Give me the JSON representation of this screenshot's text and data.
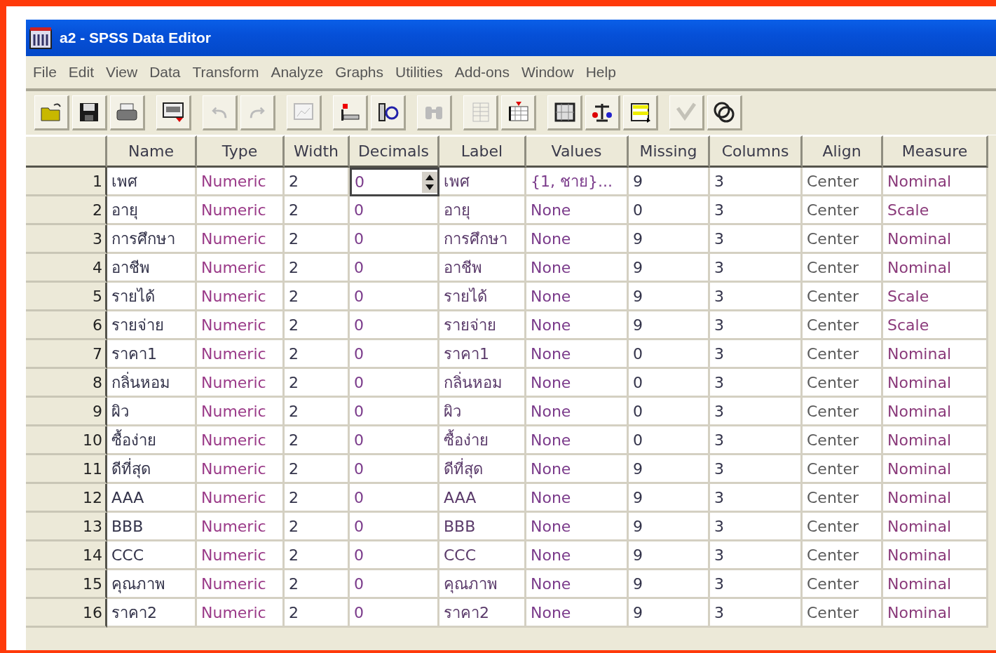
{
  "window": {
    "title": "a2 - SPSS Data Editor"
  },
  "menu": [
    "File",
    "Edit",
    "View",
    "Data",
    "Transform",
    "Analyze",
    "Graphs",
    "Utilities",
    "Add-ons",
    "Window",
    "Help"
  ],
  "toolbar": [
    {
      "disabled": false
    },
    {
      "disabled": false
    },
    {
      "disabled": false
    },
    {
      "disabled": false
    },
    {
      "disabled": true
    },
    {
      "disabled": true
    },
    {
      "disabled": true
    },
    {
      "disabled": false
    },
    {
      "disabled": false
    },
    {
      "disabled": true
    },
    {
      "disabled": true
    },
    {
      "disabled": false
    },
    {
      "disabled": false
    },
    {
      "disabled": false
    },
    {
      "disabled": false
    },
    {
      "disabled": true
    },
    {
      "disabled": false
    }
  ],
  "table": {
    "columns": [
      "Name",
      "Type",
      "Width",
      "Decimals",
      "Label",
      "Values",
      "Missing",
      "Columns",
      "Align",
      "Measure"
    ],
    "rows": [
      {
        "number": "1",
        "cells": [
          "เพศ",
          "Numeric",
          "2",
          "0",
          "เพศ",
          "{1, ชาย}...",
          "9",
          "3",
          "Center",
          "Nominal"
        ],
        "editing_decimals": true
      },
      {
        "number": "2",
        "cells": [
          "อายุ",
          "Numeric",
          "2",
          "0",
          "อายุ",
          "None",
          "0",
          "3",
          "Center",
          "Scale"
        ],
        "editing_decimals": false
      },
      {
        "number": "3",
        "cells": [
          "การศึกษา",
          "Numeric",
          "2",
          "0",
          "การศึกษา",
          "None",
          "9",
          "3",
          "Center",
          "Nominal"
        ],
        "editing_decimals": false
      },
      {
        "number": "4",
        "cells": [
          "อาชีพ",
          "Numeric",
          "2",
          "0",
          "อาชีพ",
          "None",
          "9",
          "3",
          "Center",
          "Nominal"
        ],
        "editing_decimals": false
      },
      {
        "number": "5",
        "cells": [
          "รายได้",
          "Numeric",
          "2",
          "0",
          "รายได้",
          "None",
          "9",
          "3",
          "Center",
          "Scale"
        ],
        "editing_decimals": false
      },
      {
        "number": "6",
        "cells": [
          "รายจ่าย",
          "Numeric",
          "2",
          "0",
          "รายจ่าย",
          "None",
          "9",
          "3",
          "Center",
          "Scale"
        ],
        "editing_decimals": false
      },
      {
        "number": "7",
        "cells": [
          "ราคา1",
          "Numeric",
          "2",
          "0",
          "ราคา1",
          "None",
          "0",
          "3",
          "Center",
          "Nominal"
        ],
        "editing_decimals": false
      },
      {
        "number": "8",
        "cells": [
          "กลิ่นหอม",
          "Numeric",
          "2",
          "0",
          "กลิ่นหอม",
          "None",
          "0",
          "3",
          "Center",
          "Nominal"
        ],
        "editing_decimals": false
      },
      {
        "number": "9",
        "cells": [
          "ผิว",
          "Numeric",
          "2",
          "0",
          "ผิว",
          "None",
          "0",
          "3",
          "Center",
          "Nominal"
        ],
        "editing_decimals": false
      },
      {
        "number": "10",
        "cells": [
          "ซื้อง่าย",
          "Numeric",
          "2",
          "0",
          "ซื้อง่าย",
          "None",
          "0",
          "3",
          "Center",
          "Nominal"
        ],
        "editing_decimals": false
      },
      {
        "number": "11",
        "cells": [
          "ดีที่สุด",
          "Numeric",
          "2",
          "0",
          "ดีที่สุด",
          "None",
          "9",
          "3",
          "Center",
          "Nominal"
        ],
        "editing_decimals": false
      },
      {
        "number": "12",
        "cells": [
          "AAA",
          "Numeric",
          "2",
          "0",
          "AAA",
          "None",
          "9",
          "3",
          "Center",
          "Nominal"
        ],
        "editing_decimals": false
      },
      {
        "number": "13",
        "cells": [
          "BBB",
          "Numeric",
          "2",
          "0",
          "BBB",
          "None",
          "9",
          "3",
          "Center",
          "Nominal"
        ],
        "editing_decimals": false
      },
      {
        "number": "14",
        "cells": [
          "CCC",
          "Numeric",
          "2",
          "0",
          "CCC",
          "None",
          "9",
          "3",
          "Center",
          "Nominal"
        ],
        "editing_decimals": false
      },
      {
        "number": "15",
        "cells": [
          "คุณภาพ",
          "Numeric",
          "2",
          "0",
          "คุณภาพ",
          "None",
          "9",
          "3",
          "Center",
          "Nominal"
        ],
        "editing_decimals": false
      },
      {
        "number": "16",
        "cells": [
          "ราคา2",
          "Numeric",
          "2",
          "0",
          "ราคา2",
          "None",
          "9",
          "3",
          "Center",
          "Nominal"
        ],
        "editing_decimals": false
      }
    ]
  }
}
